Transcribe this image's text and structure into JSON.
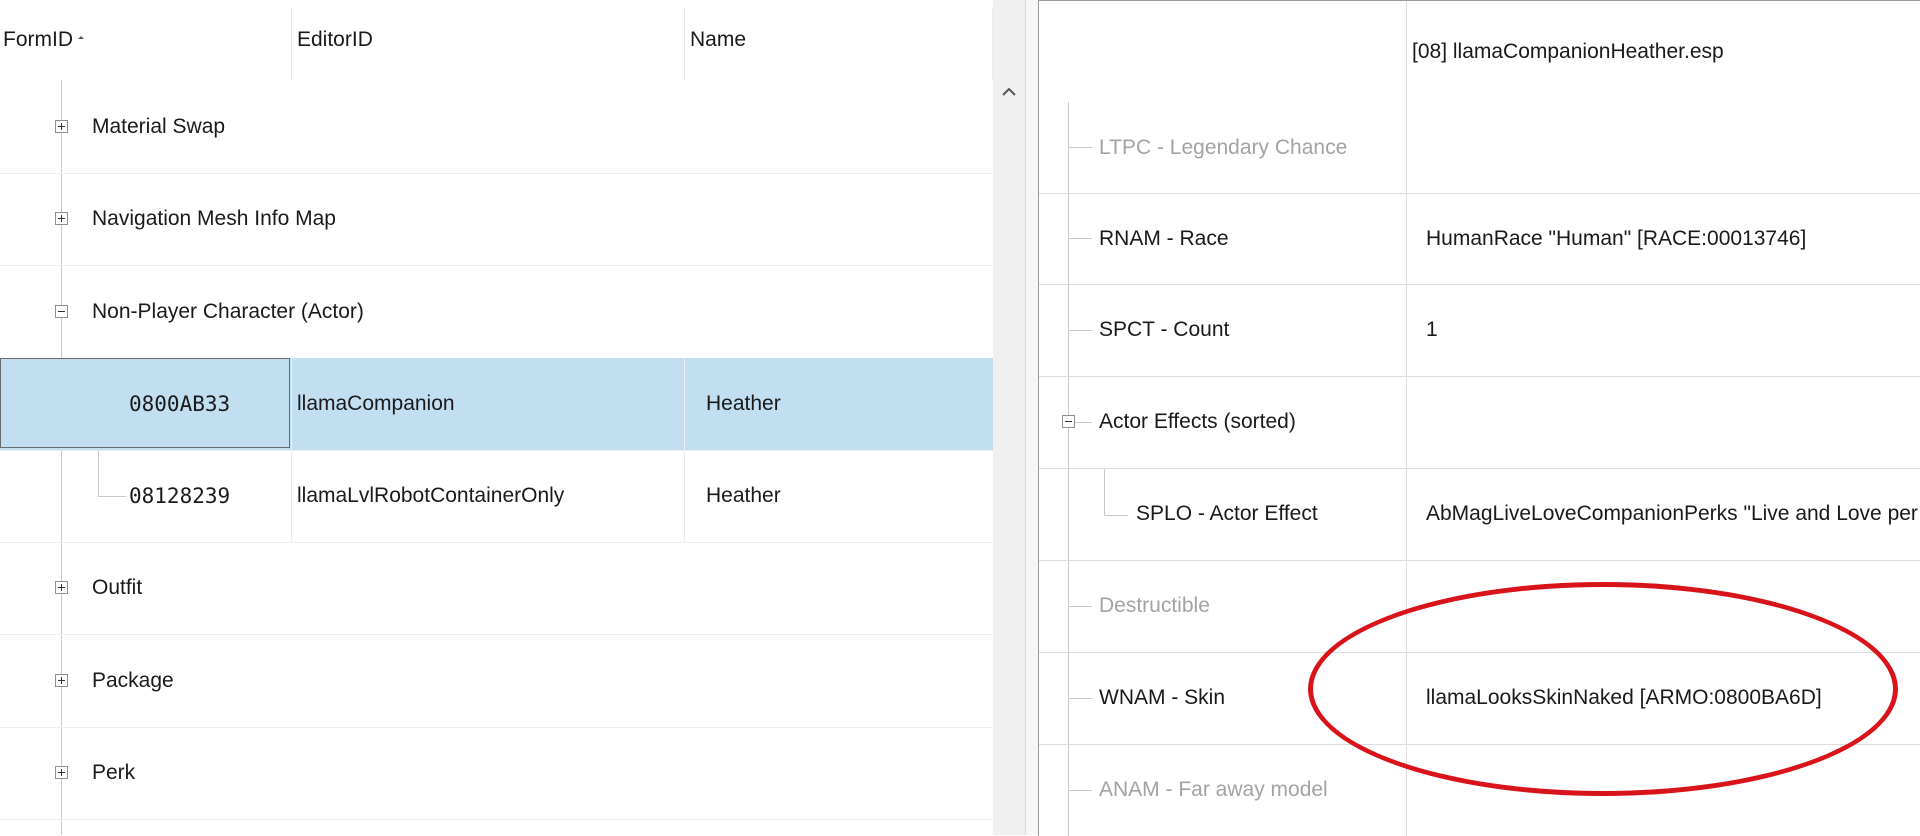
{
  "left_tree": {
    "columns": [
      "FormID",
      "EditorID",
      "Name"
    ],
    "rows": [
      {
        "label": "Material Swap",
        "expanded": false
      },
      {
        "label": "Navigation Mesh Info Map",
        "expanded": false
      },
      {
        "label": "Non-Player Character (Actor)",
        "expanded": true
      },
      {
        "formid": "0800AB33",
        "editorid": "llamaCompanion",
        "name": "Heather",
        "selected": true
      },
      {
        "formid": "08128239",
        "editorid": "llamaLvlRobotContainerOnly",
        "name": "Heather",
        "selected": false
      },
      {
        "label": "Outfit",
        "expanded": false
      },
      {
        "label": "Package",
        "expanded": false
      },
      {
        "label": "Perk",
        "expanded": false
      }
    ]
  },
  "record_view": {
    "plugin_header": "[08] llamaCompanionHeather.esp",
    "rows": [
      {
        "label": "LTPC - Legendary Chance",
        "value": "",
        "dim": true
      },
      {
        "label": "RNAM - Race",
        "value": "HumanRace \"Human\" [RACE:00013746]",
        "dim": false
      },
      {
        "label": "SPCT - Count",
        "value": "1",
        "dim": false
      },
      {
        "label": "Actor Effects (sorted)",
        "value": "",
        "dim": false,
        "group": true
      },
      {
        "label": "SPLO - Actor Effect",
        "value": "AbMagLiveLoveCompanionPerks \"Live and Love per",
        "dim": false,
        "child": true
      },
      {
        "label": "Destructible",
        "value": "",
        "dim": true
      },
      {
        "label": "WNAM - Skin",
        "value": "llamaLooksSkinNaked [ARMO:0800BA6D]",
        "dim": false
      },
      {
        "label": "ANAM - Far away model",
        "value": "",
        "dim": true
      }
    ]
  },
  "annotation": {
    "shape": "ellipse",
    "color": "#d9131a",
    "target": "WNAM - Skin value"
  },
  "colors": {
    "selection": "#c2dff2",
    "dim_text": "#a3a3a3"
  }
}
